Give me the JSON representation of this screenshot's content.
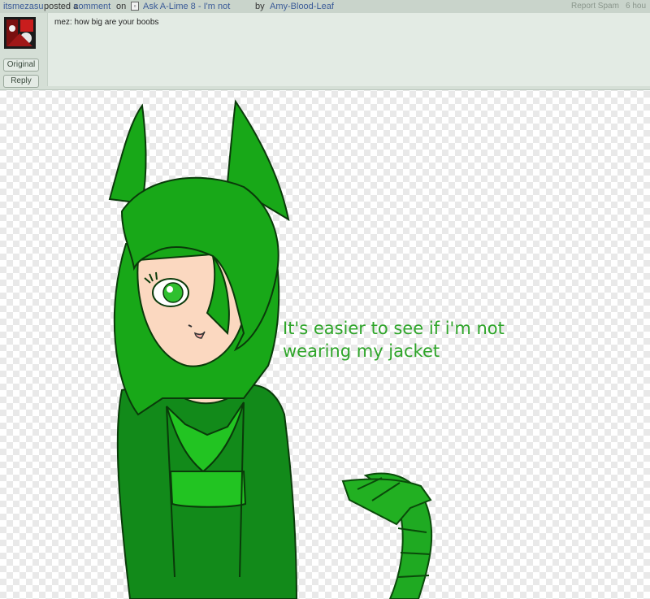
{
  "comment": {
    "username": "itsmezasu",
    "posted_text": "posted a",
    "comment_link": "comment",
    "on_text": "on",
    "deviation_title": "Ask A-Lime 8 - I'm not",
    "by_text": "by",
    "author": "Amy-Blood-Leaf",
    "report_spam": "Report Spam",
    "time": "6 hou",
    "text": "mez: how big are your boobs",
    "original_button": "Original",
    "reply_button": "Reply"
  },
  "artwork": {
    "speech": "It's easier to see if i'm not wearing my jacket"
  },
  "colors": {
    "hair": "#18a818",
    "jacket": "#128a1a",
    "skin": "#fbd8c0",
    "speech_text": "#2fa52a"
  }
}
